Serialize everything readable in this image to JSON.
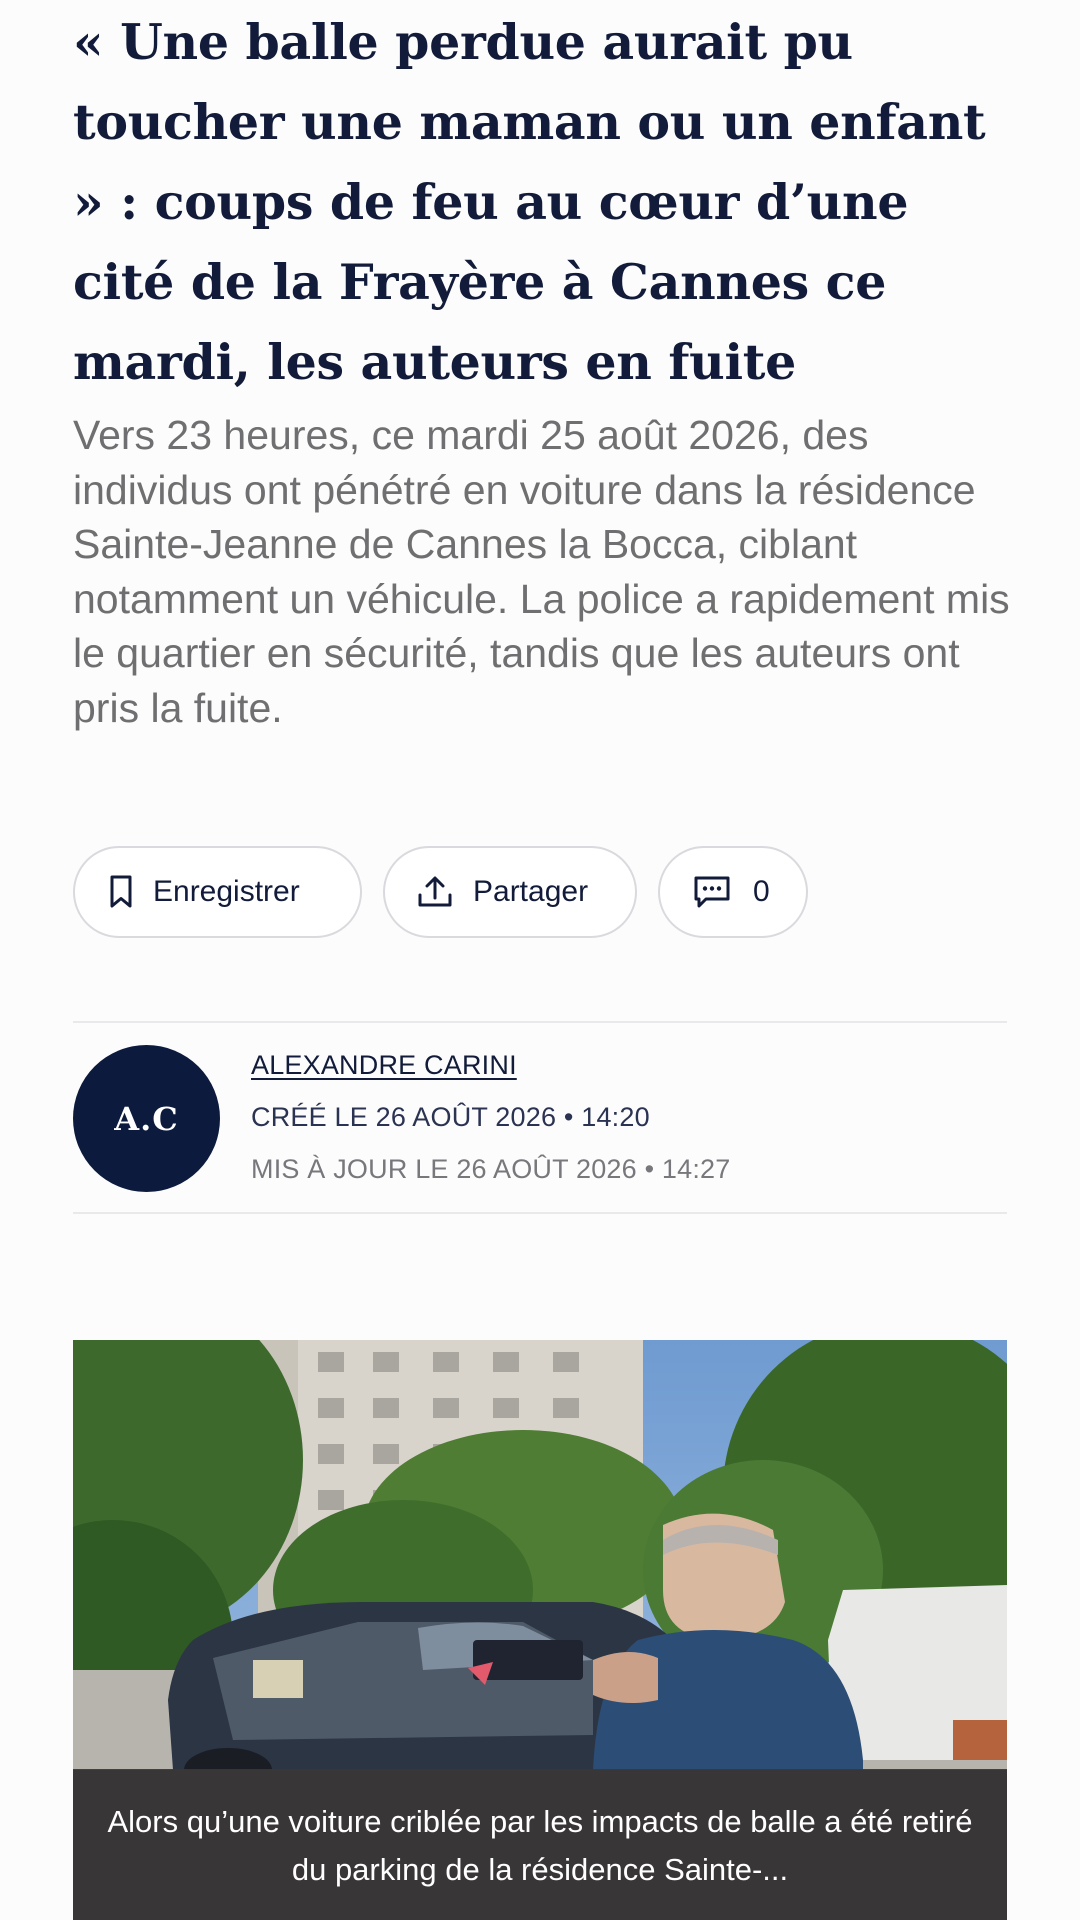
{
  "article": {
    "headline": "« Une balle perdue aurait pu toucher une maman ou un enfant » : coups de feu au cœur d’une cité de la Frayère à Cannes ce mardi, les auteurs en fuite",
    "lede": "Vers 23 heures, ce mardi 25 août 2026, des individus ont pénétré en voiture dans la résidence Sainte-Jeanne de Cannes la Bocca, ciblant notamment un véhicule. La police a rapidement mis le quartier en sécurité, tandis que les auteurs ont pris la fuite."
  },
  "actions": {
    "save_label": "Enregistrer",
    "share_label": "Partager",
    "comments_count": "0"
  },
  "byline": {
    "initials": "A.C",
    "author": "ALEXANDRE CARINI",
    "created": "CRÉÉ LE 26 AOÛT 2026 • 14:20",
    "updated": "MIS À JOUR LE 26 AOÛT 2026 • 14:27"
  },
  "photo": {
    "caption": "Alors qu’une voiture criblée par les impacts de balle a été retiré du parking de la résidence Sainte-..."
  },
  "colors": {
    "headline": "#121c3a",
    "lede": "#6f6f71",
    "avatar_bg": "#0c1a3d",
    "pill_border": "#d9d9de",
    "caption_bg": "#3a3638"
  },
  "icons": {
    "save": "bookmark-icon",
    "share": "share-upload-icon",
    "comments": "comment-bubble-icon"
  }
}
